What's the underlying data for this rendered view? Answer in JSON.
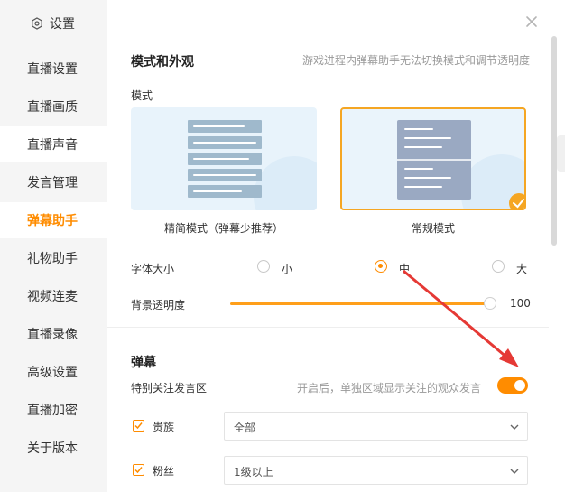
{
  "sidebar": {
    "title": "设置",
    "items": [
      {
        "label": "直播设置"
      },
      {
        "label": "直播画质"
      },
      {
        "label": "直播声音"
      },
      {
        "label": "发言管理"
      },
      {
        "label": "弹幕助手"
      },
      {
        "label": "礼物助手"
      },
      {
        "label": "视频连麦"
      },
      {
        "label": "直播录像"
      },
      {
        "label": "高级设置"
      },
      {
        "label": "直播加密"
      },
      {
        "label": "关于版本"
      }
    ],
    "active": "弹幕助手"
  },
  "mode_section": {
    "title": "模式和外观",
    "note": "游戏进程内弹幕助手无法切换模式和调节透明度",
    "mode_label": "模式",
    "modes": [
      {
        "label": "精简模式（弹幕少推荐）",
        "selected": false
      },
      {
        "label": "常规模式",
        "selected": true
      }
    ],
    "font_size": {
      "label": "字体大小",
      "options": [
        "小",
        "中",
        "大"
      ],
      "selected": "中"
    },
    "opacity": {
      "label": "背景透明度",
      "value": "100"
    }
  },
  "danmu_section": {
    "title": "弹幕",
    "follow_zone": {
      "label": "特别关注发言区",
      "note": "开启后，单独区域显示关注的观众发言",
      "enabled": true
    },
    "filters": [
      {
        "label": "贵族",
        "checked": true,
        "value": "全部"
      },
      {
        "label": "粉丝",
        "checked": true,
        "value": "1级以上"
      }
    ]
  },
  "colors": {
    "accent": "#ff8c00",
    "annotation_arrow": "#e53935"
  }
}
